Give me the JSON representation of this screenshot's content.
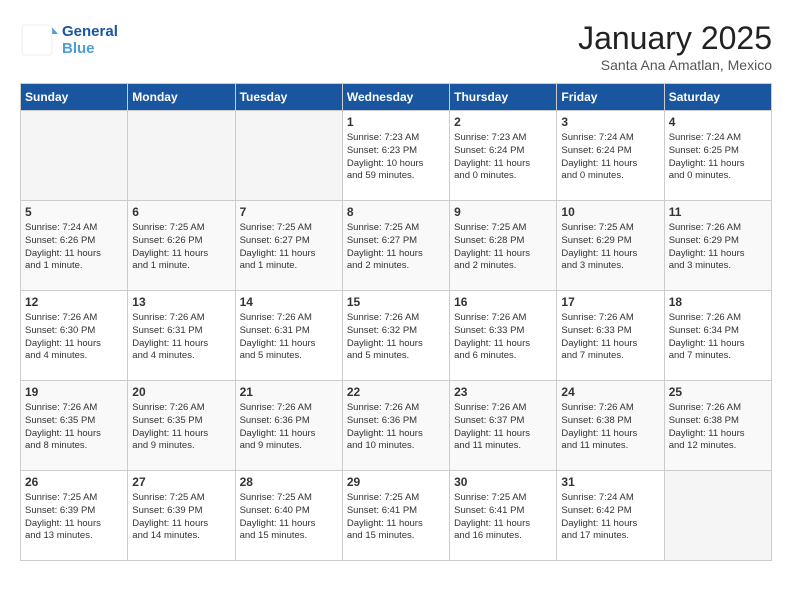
{
  "header": {
    "logo_line1": "General",
    "logo_line2": "Blue",
    "month_title": "January 2025",
    "location": "Santa Ana Amatlan, Mexico"
  },
  "days_of_week": [
    "Sunday",
    "Monday",
    "Tuesday",
    "Wednesday",
    "Thursday",
    "Friday",
    "Saturday"
  ],
  "weeks": [
    [
      {
        "day": "",
        "info": ""
      },
      {
        "day": "",
        "info": ""
      },
      {
        "day": "",
        "info": ""
      },
      {
        "day": "1",
        "info": "Sunrise: 7:23 AM\nSunset: 6:23 PM\nDaylight: 10 hours\nand 59 minutes."
      },
      {
        "day": "2",
        "info": "Sunrise: 7:23 AM\nSunset: 6:24 PM\nDaylight: 11 hours\nand 0 minutes."
      },
      {
        "day": "3",
        "info": "Sunrise: 7:24 AM\nSunset: 6:24 PM\nDaylight: 11 hours\nand 0 minutes."
      },
      {
        "day": "4",
        "info": "Sunrise: 7:24 AM\nSunset: 6:25 PM\nDaylight: 11 hours\nand 0 minutes."
      }
    ],
    [
      {
        "day": "5",
        "info": "Sunrise: 7:24 AM\nSunset: 6:26 PM\nDaylight: 11 hours\nand 1 minute."
      },
      {
        "day": "6",
        "info": "Sunrise: 7:25 AM\nSunset: 6:26 PM\nDaylight: 11 hours\nand 1 minute."
      },
      {
        "day": "7",
        "info": "Sunrise: 7:25 AM\nSunset: 6:27 PM\nDaylight: 11 hours\nand 1 minute."
      },
      {
        "day": "8",
        "info": "Sunrise: 7:25 AM\nSunset: 6:27 PM\nDaylight: 11 hours\nand 2 minutes."
      },
      {
        "day": "9",
        "info": "Sunrise: 7:25 AM\nSunset: 6:28 PM\nDaylight: 11 hours\nand 2 minutes."
      },
      {
        "day": "10",
        "info": "Sunrise: 7:25 AM\nSunset: 6:29 PM\nDaylight: 11 hours\nand 3 minutes."
      },
      {
        "day": "11",
        "info": "Sunrise: 7:26 AM\nSunset: 6:29 PM\nDaylight: 11 hours\nand 3 minutes."
      }
    ],
    [
      {
        "day": "12",
        "info": "Sunrise: 7:26 AM\nSunset: 6:30 PM\nDaylight: 11 hours\nand 4 minutes."
      },
      {
        "day": "13",
        "info": "Sunrise: 7:26 AM\nSunset: 6:31 PM\nDaylight: 11 hours\nand 4 minutes."
      },
      {
        "day": "14",
        "info": "Sunrise: 7:26 AM\nSunset: 6:31 PM\nDaylight: 11 hours\nand 5 minutes."
      },
      {
        "day": "15",
        "info": "Sunrise: 7:26 AM\nSunset: 6:32 PM\nDaylight: 11 hours\nand 5 minutes."
      },
      {
        "day": "16",
        "info": "Sunrise: 7:26 AM\nSunset: 6:33 PM\nDaylight: 11 hours\nand 6 minutes."
      },
      {
        "day": "17",
        "info": "Sunrise: 7:26 AM\nSunset: 6:33 PM\nDaylight: 11 hours\nand 7 minutes."
      },
      {
        "day": "18",
        "info": "Sunrise: 7:26 AM\nSunset: 6:34 PM\nDaylight: 11 hours\nand 7 minutes."
      }
    ],
    [
      {
        "day": "19",
        "info": "Sunrise: 7:26 AM\nSunset: 6:35 PM\nDaylight: 11 hours\nand 8 minutes."
      },
      {
        "day": "20",
        "info": "Sunrise: 7:26 AM\nSunset: 6:35 PM\nDaylight: 11 hours\nand 9 minutes."
      },
      {
        "day": "21",
        "info": "Sunrise: 7:26 AM\nSunset: 6:36 PM\nDaylight: 11 hours\nand 9 minutes."
      },
      {
        "day": "22",
        "info": "Sunrise: 7:26 AM\nSunset: 6:36 PM\nDaylight: 11 hours\nand 10 minutes."
      },
      {
        "day": "23",
        "info": "Sunrise: 7:26 AM\nSunset: 6:37 PM\nDaylight: 11 hours\nand 11 minutes."
      },
      {
        "day": "24",
        "info": "Sunrise: 7:26 AM\nSunset: 6:38 PM\nDaylight: 11 hours\nand 11 minutes."
      },
      {
        "day": "25",
        "info": "Sunrise: 7:26 AM\nSunset: 6:38 PM\nDaylight: 11 hours\nand 12 minutes."
      }
    ],
    [
      {
        "day": "26",
        "info": "Sunrise: 7:25 AM\nSunset: 6:39 PM\nDaylight: 11 hours\nand 13 minutes."
      },
      {
        "day": "27",
        "info": "Sunrise: 7:25 AM\nSunset: 6:39 PM\nDaylight: 11 hours\nand 14 minutes."
      },
      {
        "day": "28",
        "info": "Sunrise: 7:25 AM\nSunset: 6:40 PM\nDaylight: 11 hours\nand 15 minutes."
      },
      {
        "day": "29",
        "info": "Sunrise: 7:25 AM\nSunset: 6:41 PM\nDaylight: 11 hours\nand 15 minutes."
      },
      {
        "day": "30",
        "info": "Sunrise: 7:25 AM\nSunset: 6:41 PM\nDaylight: 11 hours\nand 16 minutes."
      },
      {
        "day": "31",
        "info": "Sunrise: 7:24 AM\nSunset: 6:42 PM\nDaylight: 11 hours\nand 17 minutes."
      },
      {
        "day": "",
        "info": ""
      }
    ]
  ]
}
